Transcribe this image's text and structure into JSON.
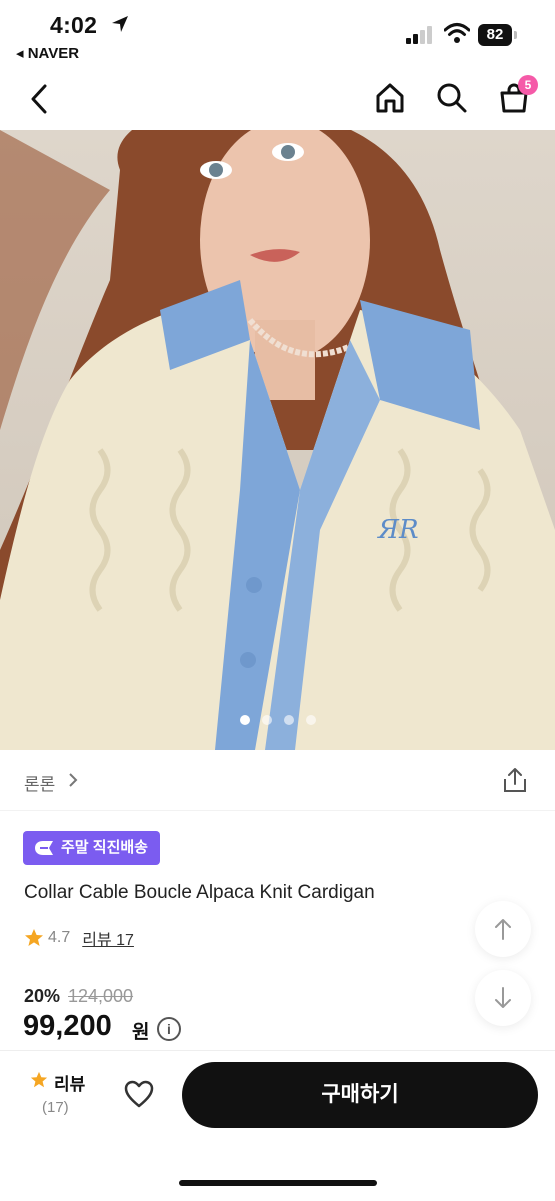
{
  "status_bar": {
    "time": "4:02",
    "back_app": "◂ NAVER",
    "battery": "82"
  },
  "nav": {
    "cart_count": "5"
  },
  "gallery": {
    "slides": 4,
    "active_slide": 1
  },
  "product": {
    "brand": "론론",
    "badge": "주말 직진배송",
    "title": "Collar Cable Boucle Alpaca Knit Cardigan",
    "rating": "4.7",
    "reviews_link": "리뷰 17",
    "discount": "20%",
    "original_price": "124,000",
    "price": "99,200",
    "currency": "원"
  },
  "bottom": {
    "review_label": "리뷰",
    "review_count": "(17)",
    "buy_label": "구매하기"
  },
  "colors": {
    "badge": "#7b5cf0",
    "cart_badge": "#f55aa8",
    "star": "#f5a623",
    "buy_button": "#111111"
  }
}
